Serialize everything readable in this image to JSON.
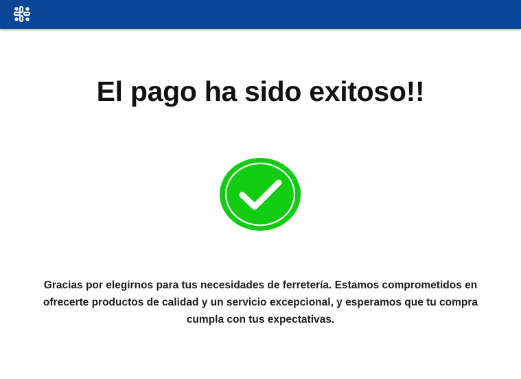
{
  "header": {
    "logo_icon": "hardware-store-logo-icon",
    "bar_color": "#0b4696"
  },
  "main": {
    "title": "El pago ha sido exitoso!!",
    "success_icon": "check-circle-icon",
    "success_color": "#11cc11",
    "message": "Gracias por elegirnos para tus necesidades de ferretería. Estamos comprometidos en ofrecerte productos de calidad y un servicio excepcional, y esperamos que tu compra cumpla con tus expectativas."
  }
}
